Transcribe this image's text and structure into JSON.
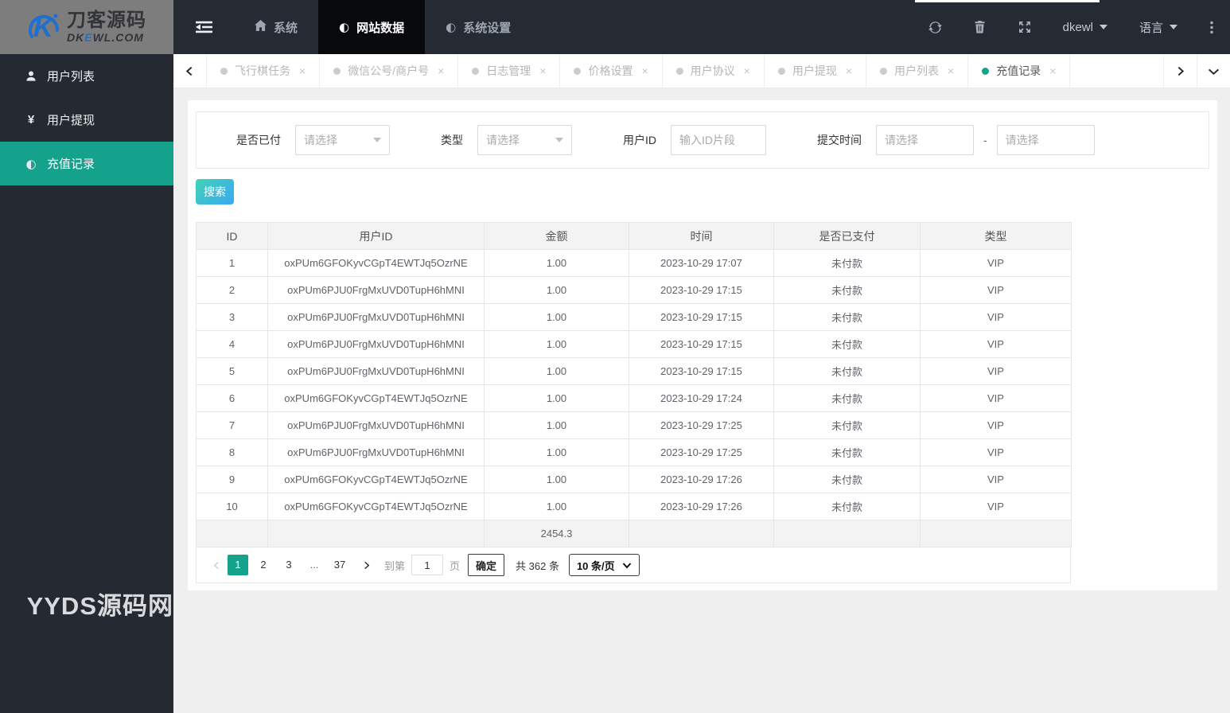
{
  "colors": {
    "accent": "#15a28d",
    "header_bg": "#262b33",
    "sidebar_bg": "#252a32",
    "active_nav_bg": "#07090d",
    "logo_bg": "#7d7d7d",
    "search_gradient_start": "#40d3b6",
    "search_gradient_end": "#3aa9f2"
  },
  "brand": {
    "logo_cn": "刀客源码",
    "logo_domain_pre": "DK",
    "logo_domain_accent": "E",
    "logo_domain_post": "WL.COM"
  },
  "topnav": {
    "items": [
      {
        "label": "系统",
        "icon": "home-icon",
        "active": false
      },
      {
        "label": "网站数据",
        "icon": "adjust-icon",
        "active": true
      },
      {
        "label": "系统设置",
        "icon": "adjust-icon",
        "active": false
      }
    ],
    "username": "dkewl",
    "language_label": "语言"
  },
  "sidebar": {
    "items": [
      {
        "label": "用户列表",
        "icon": "user-icon",
        "active": false
      },
      {
        "label": "用户提现",
        "icon": "yen-icon",
        "active": false
      },
      {
        "label": "充值记录",
        "icon": "adjust-icon",
        "active": true
      }
    ],
    "watermark": "YYDS源码网"
  },
  "tabs": {
    "items": [
      {
        "label": "飞行棋任务"
      },
      {
        "label": "微信公号/商户号"
      },
      {
        "label": "日志管理"
      },
      {
        "label": "价格设置"
      },
      {
        "label": "用户协议"
      },
      {
        "label": "用户提现"
      },
      {
        "label": "用户列表"
      },
      {
        "label": "充值记录"
      }
    ],
    "active_index": 7,
    "close_glyph": "×"
  },
  "filters": {
    "paid": {
      "label": "是否已付",
      "placeholder": "请选择"
    },
    "type": {
      "label": "类型",
      "placeholder": "请选择"
    },
    "user_id": {
      "label": "用户ID",
      "placeholder": "输入ID片段"
    },
    "submit_time": {
      "label": "提交时间",
      "start_placeholder": "请选择",
      "end_placeholder": "请选择",
      "separator": "-"
    }
  },
  "search_button_label": "搜索",
  "table": {
    "columns": [
      "ID",
      "用户ID",
      "金额",
      "时间",
      "是否已支付",
      "类型"
    ],
    "rows": [
      [
        "1",
        "oxPUm6GFOKyvCGpT4EWTJq5OzrNE",
        "1.00",
        "2023-10-29 17:07",
        "未付款",
        "VIP"
      ],
      [
        "2",
        "oxPUm6PJU0FrgMxUVD0TupH6hMNI",
        "1.00",
        "2023-10-29 17:15",
        "未付款",
        "VIP"
      ],
      [
        "3",
        "oxPUm6PJU0FrgMxUVD0TupH6hMNI",
        "1.00",
        "2023-10-29 17:15",
        "未付款",
        "VIP"
      ],
      [
        "4",
        "oxPUm6PJU0FrgMxUVD0TupH6hMNI",
        "1.00",
        "2023-10-29 17:15",
        "未付款",
        "VIP"
      ],
      [
        "5",
        "oxPUm6PJU0FrgMxUVD0TupH6hMNI",
        "1.00",
        "2023-10-29 17:15",
        "未付款",
        "VIP"
      ],
      [
        "6",
        "oxPUm6GFOKyvCGpT4EWTJq5OzrNE",
        "1.00",
        "2023-10-29 17:24",
        "未付款",
        "VIP"
      ],
      [
        "7",
        "oxPUm6PJU0FrgMxUVD0TupH6hMNI",
        "1.00",
        "2023-10-29 17:25",
        "未付款",
        "VIP"
      ],
      [
        "8",
        "oxPUm6PJU0FrgMxUVD0TupH6hMNI",
        "1.00",
        "2023-10-29 17:25",
        "未付款",
        "VIP"
      ],
      [
        "9",
        "oxPUm6GFOKyvCGpT4EWTJq5OzrNE",
        "1.00",
        "2023-10-29 17:26",
        "未付款",
        "VIP"
      ],
      [
        "10",
        "oxPUm6GFOKyvCGpT4EWTJq5OzrNE",
        "1.00",
        "2023-10-29 17:26",
        "未付款",
        "VIP"
      ]
    ],
    "summary_amount": "2454.3"
  },
  "pagination": {
    "pages": [
      "1",
      "2",
      "3",
      "...",
      "37"
    ],
    "active_page": "1",
    "goto_label": "到第",
    "goto_value": "1",
    "page_unit": "页",
    "confirm_label": "确定",
    "total_label": "共 362 条",
    "page_size_label": "10 条/页"
  }
}
